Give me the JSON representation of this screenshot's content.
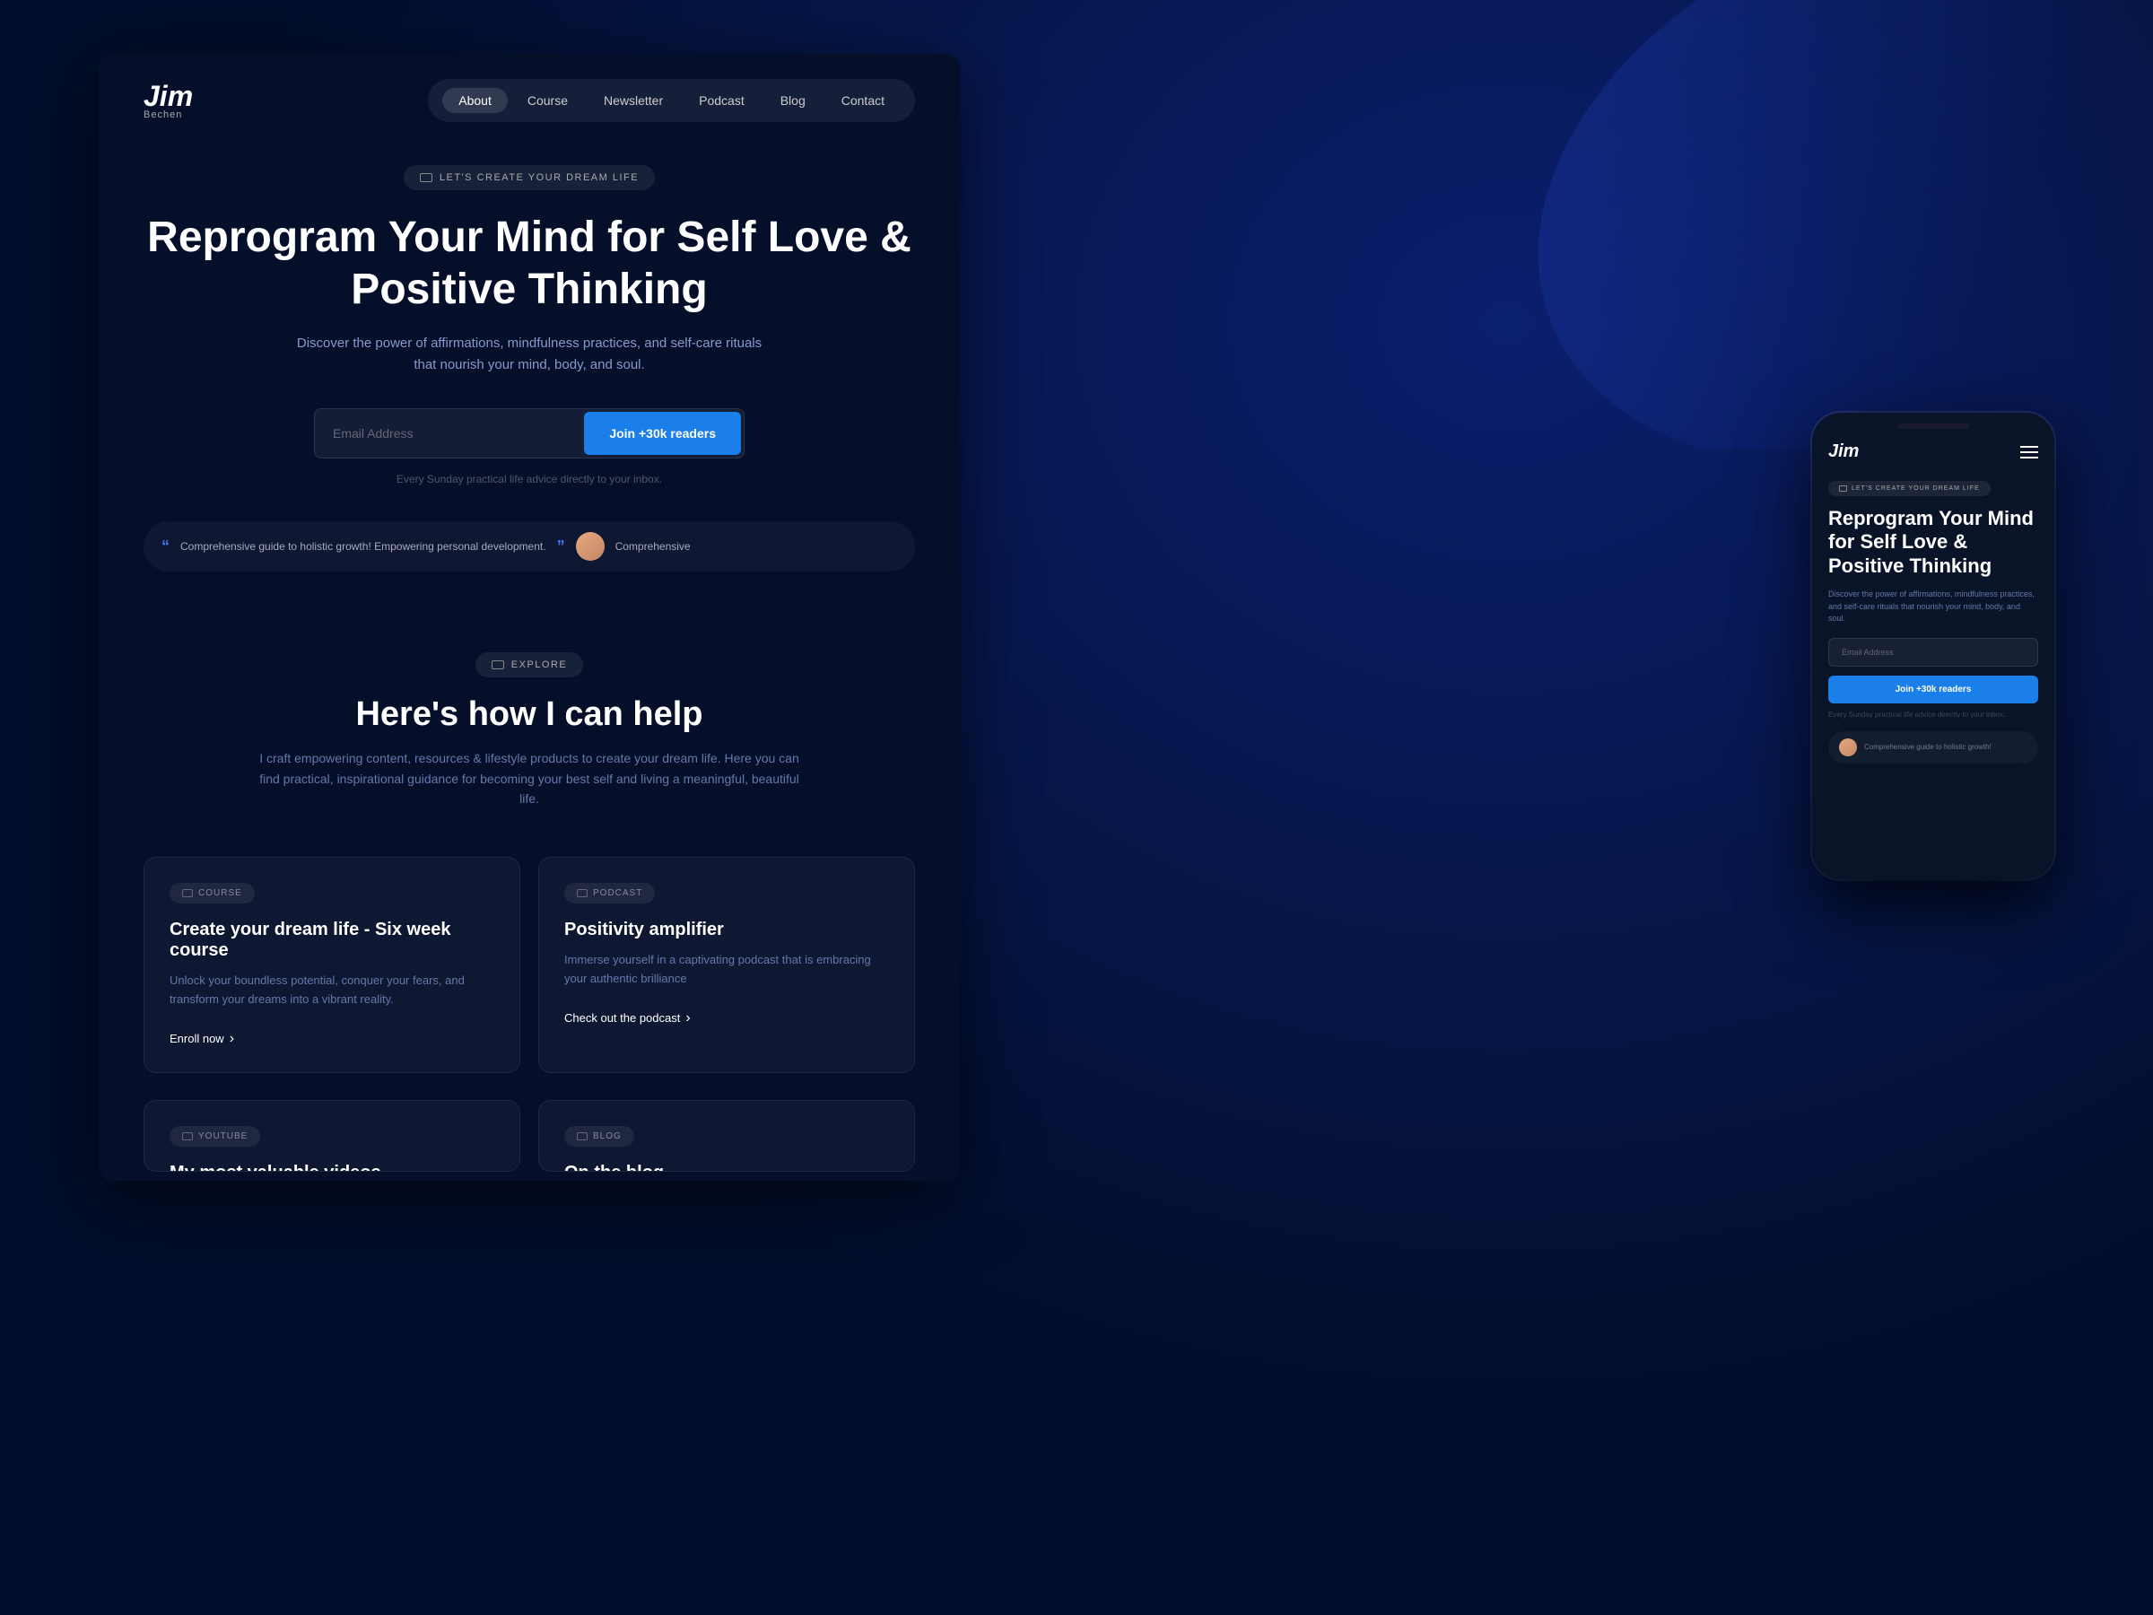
{
  "meta": {
    "bg_color": "#020e2b",
    "accent_color": "#1a7fe8"
  },
  "logo": {
    "name": "Jim",
    "subname": "Bechen"
  },
  "nav": {
    "links": [
      {
        "label": "About",
        "active": true
      },
      {
        "label": "Course",
        "active": false
      },
      {
        "label": "Newsletter",
        "active": false
      },
      {
        "label": "Podcast",
        "active": false
      },
      {
        "label": "Blog",
        "active": false
      },
      {
        "label": "Contact",
        "active": false
      }
    ]
  },
  "hero": {
    "badge_text": "LET'S CREATE YOUR DREAM LIFE",
    "title": "Reprogram Your Mind for Self Love & Positive Thinking",
    "subtitle": "Discover the power of affirmations, mindfulness practices, and self-care rituals that nourish your mind, body, and soul.",
    "email_placeholder": "Email Address",
    "cta_label": "Join +30k readers",
    "note": "Every Sunday practical life advice directly to your inbox.",
    "testimonial_quote": "Comprehensive guide to holistic growth! Empowering personal development.",
    "testimonial_more": "Comprehensive"
  },
  "explore": {
    "badge_text": "EXPLORE",
    "title": "Here's how I can help",
    "description": "I craft empowering content, resources & lifestyle products to create your dream life. Here you can find practical, inspirational guidance for becoming your best self and living a meaningful, beautiful life."
  },
  "cards": [
    {
      "tag": "COURSE",
      "tag_type": "monitor",
      "title": "Create your dream life - Six week course",
      "description": "Unlock your boundless potential, conquer your fears, and transform your dreams into a vibrant reality.",
      "link_label": "Enroll now",
      "link_arrow": "›"
    },
    {
      "tag": "PODCAST",
      "tag_type": "download",
      "title": "Positivity amplifier",
      "description": "Immerse yourself in a captivating podcast that is embracing your authentic brilliance",
      "link_label": "Check out the podcast",
      "link_arrow": "›"
    },
    {
      "tag": "YOUTUBE",
      "tag_type": "play",
      "title": "My most valuable videos",
      "description": "",
      "link_label": "",
      "link_arrow": ""
    },
    {
      "tag": "BLOG",
      "tag_type": "edit",
      "title": "On the blog",
      "description": "",
      "link_label": "",
      "link_arrow": ""
    }
  ],
  "mobile": {
    "logo": "Jim",
    "badge_text": "LET'S CREATE YOUR DREAM LIFE",
    "title": "Reprogram Your Mind for Self Love & Positive Thinking",
    "subtitle": "Discover the power of affirmations, mindfulness practices, and self-care rituals that nourish your mind, body, and soul.",
    "email_placeholder": "Email Address",
    "cta_label": "Join +30k readers",
    "note": "Every Sunday practical life advice directly to your inbox.",
    "testimonial": "Comprehensive guide to holistic growth!"
  }
}
